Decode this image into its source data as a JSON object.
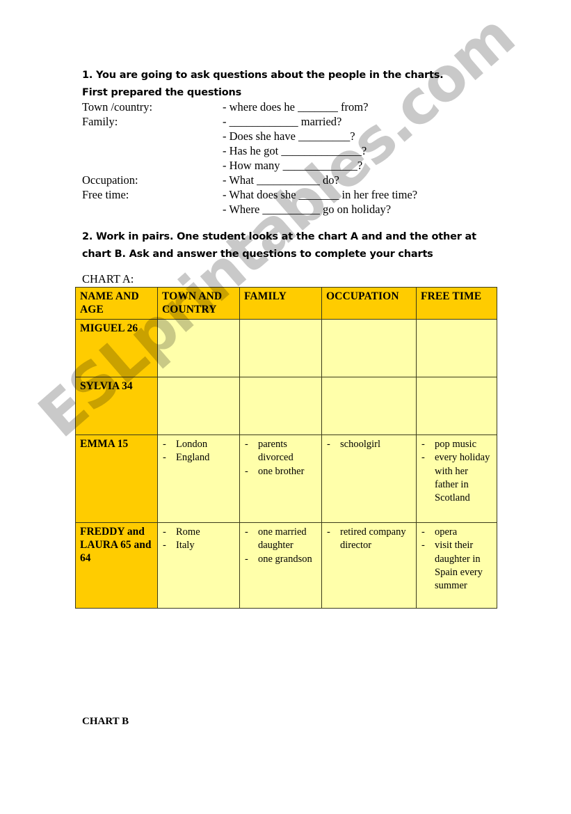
{
  "instructions": {
    "step1": "1. You are going to ask questions about the people in the charts. First prepared the questions",
    "step2": "2. Work in pairs. One student looks at the chart A and and the other at chart B. Ask and answer the questions to complete your charts"
  },
  "questions": [
    {
      "label": "Town /country:",
      "text": "- where does he _______ from?"
    },
    {
      "label": "Family:",
      "text": "- ____________ married?"
    },
    {
      "label": "",
      "text": "- Does she have _________?"
    },
    {
      "label": "",
      "text": "- Has he got ______________?"
    },
    {
      "label": "",
      "text": "- How many _____________?"
    },
    {
      "label": "Occupation:",
      "text": "- What ___________ do?"
    },
    {
      "label": "Free time:",
      "text": "- What does she _______ in her free time?"
    },
    {
      "label": "",
      "text": "- Where __________ go on holiday?"
    }
  ],
  "chart_a": {
    "label": "CHART A:",
    "columns": [
      "NAME AND AGE",
      "TOWN AND COUNTRY",
      "FAMILY",
      "OCCUPATION",
      "FREE TIME"
    ],
    "rows": [
      {
        "name": "MIGUEL 26",
        "town": [],
        "family": [],
        "occupation": [],
        "free_time": []
      },
      {
        "name": "SYLVIA 34",
        "town": [],
        "family": [],
        "occupation": [],
        "free_time": []
      },
      {
        "name": "EMMA 15",
        "town": [
          "London",
          "England"
        ],
        "family": [
          "parents divorced",
          "one brother"
        ],
        "occupation": [
          "schoolgirl"
        ],
        "free_time": [
          "pop music",
          "every holiday with her father in Scotland"
        ]
      },
      {
        "name": "FREDDY and LAURA 65 and 64",
        "town": [
          "Rome",
          "Italy"
        ],
        "family": [
          "one married daughter",
          "one grandson"
        ],
        "occupation": [
          "retired company director"
        ],
        "free_time": [
          "opera",
          "visit their daughter in Spain every summer"
        ]
      }
    ]
  },
  "chart_b": {
    "label": "CHART B"
  },
  "watermark": {
    "text": "ESLprintables.com",
    "color": "#c9c9c9"
  },
  "colors": {
    "header_gold": "#ffcc00",
    "cell_yellow": "#ffffaa",
    "border": "#3a3a1a"
  }
}
